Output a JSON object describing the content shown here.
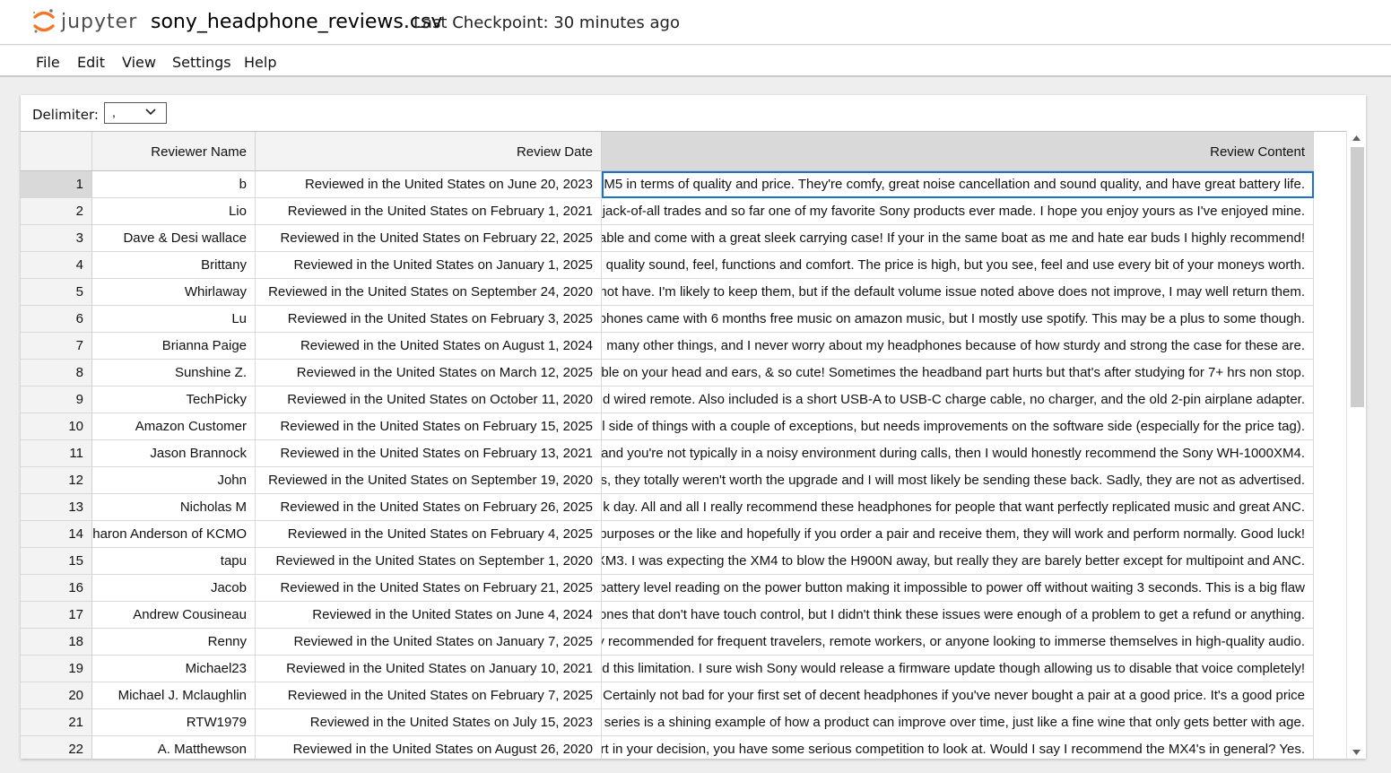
{
  "app": {
    "logo_text": "jupyter",
    "document_title": "sony_headphone_reviews.csv",
    "checkpoint": "Last Checkpoint: 30 minutes ago"
  },
  "menu": [
    "File",
    "Edit",
    "View",
    "Settings",
    "Help"
  ],
  "toolbar": {
    "delimiter_label": "Delimiter:",
    "delimiter_value": ","
  },
  "colors": {
    "selection_border": "#1a73c9",
    "header_bg": "#f3f3f3",
    "selected_header_bg": "#d9d9d9",
    "logo_orange": "#f37726"
  },
  "table": {
    "columns": [
      "Reviewer Name",
      "Review Date",
      "Review Content"
    ],
    "selected_column": "Review Content",
    "selected_row": "1",
    "rows": [
      {
        "num": "1",
        "name": "b",
        "date": "Reviewed in the United States on June 20, 2023",
        "content": "M5 in terms of quality and price. They're comfy, great noise cancellation and sound quality, and have great battery life."
      },
      {
        "num": "2",
        "name": "Lio",
        "date": "Reviewed in the United States on February 1, 2021",
        "content": "jack-of-all trades and so far one of my favorite Sony products ever made. I hope you enjoy yours as I've enjoyed mine."
      },
      {
        "num": "3",
        "name": "Dave & Desi wallace",
        "date": "Reviewed in the United States on February 22, 2025",
        "content": "able and come with a great sleek carrying case! If your in the same boat as me and hate ear buds I highly recommend!"
      },
      {
        "num": "4",
        "name": "Brittany",
        "date": "Reviewed in the United States on January 1, 2025",
        "content": " quality sound, feel, functions and comfort. The price is high, but you see, feel and use every bit of your moneys worth."
      },
      {
        "num": "5",
        "name": "Whirlaway",
        "date": "Reviewed in the United States on September 24, 2020",
        "content": "not have. I'm likely to keep them, but if the default volume issue noted above does not improve, I may well return them."
      },
      {
        "num": "6",
        "name": "Lu",
        "date": "Reviewed in the United States on February 3, 2025",
        "content": "phones came with 6 months free music on amazon music, but I mostly use spotify. This may be a plus to some though."
      },
      {
        "num": "7",
        "name": "Brianna Paige",
        "date": "Reviewed in the United States on August 1, 2024",
        "content": " many other things, and I never worry about my headphones because of how sturdy and strong the case for these are."
      },
      {
        "num": "8",
        "name": "Sunshine Z.",
        "date": "Reviewed in the United States on March 12, 2025",
        "content": "ble on your head and ears, & so cute! Sometimes the headband part hurts but that's after studying for 7+ hrs non stop."
      },
      {
        "num": "9",
        "name": "TechPicky",
        "date": "Reviewed in the United States on October 11, 2020",
        "content": "d wired remote.  Also included is a short USB-A to USB-C charge cable, no charger, and the old 2-pin airplane adapter."
      },
      {
        "num": "10",
        "name": "Amazon Customer",
        "date": "Reviewed in the United States on February 15, 2025",
        "content": "l side of things with a couple of exceptions, but needs improvements on the software side (especially for the price tag)."
      },
      {
        "num": "11",
        "name": "Jason Brannock",
        "date": "Reviewed in the United States on February 13, 2021",
        "content": "and you're not typically in a noisy environment during calls, then I would honestly recommend the Sony WH-1000XM4."
      },
      {
        "num": "12",
        "name": "John",
        "date": "Reviewed in the United States on September 19, 2020",
        "content": "s, they totally weren't worth the upgrade and I will most likely be sending these back. Sadly, they are not as advertised."
      },
      {
        "num": "13",
        "name": "Nicholas M",
        "date": "Reviewed in the United States on February 26, 2025",
        "content": "k day.  All and all I really recommend these headphones for people that want perfectly replicated music and great ANC."
      },
      {
        "num": "14",
        "name": "haron Anderson of KCMO",
        "date": "Reviewed in the United States on February 4, 2025",
        "content": "purposes or the like and hopefully if you order a pair and receive them, they will work and perform normally. Good luck!"
      },
      {
        "num": "15",
        "name": "tapu",
        "date": "Reviewed in the United States on September 1, 2020",
        "content": "XM3. I was expecting the XM4 to blow the H900N away, but really they are barely better except for multipoint and ANC."
      },
      {
        "num": "16",
        "name": "Jacob",
        "date": "Reviewed in the United States on February 21, 2025",
        "content": "battery level reading on the power button making it impossible to power off without waiting 3 seconds. This is a big flaw"
      },
      {
        "num": "17",
        "name": "Andrew Cousineau",
        "date": "Reviewed in the United States on June 4, 2024",
        "content": "ones that don't have touch control, but I didn't think these issues were enough of a problem to get a refund or anything."
      },
      {
        "num": "18",
        "name": "Renny",
        "date": "Reviewed in the United States on January 7, 2025",
        "content": "y recommended for frequent travelers, remote workers, or anyone looking to immerse themselves in high-quality audio."
      },
      {
        "num": "19",
        "name": "Michael23",
        "date": "Reviewed in the United States on January 10, 2021",
        "content": "d this limitation. I sure wish Sony would release a firmware update though allowing us to disable that voice completely!"
      },
      {
        "num": "20",
        "name": "Michael J. Mclaughlin",
        "date": "Reviewed in the United States on February 7, 2025",
        "content": "Certainly not bad for your first set of decent headphones if you've never bought a pair at a good price. It's a good price"
      },
      {
        "num": "21",
        "name": "RTW1979",
        "date": "Reviewed in the United States on July 15, 2023",
        "content": " series is a shining example of how a product can improve over time, just like a fine wine that only gets better with age."
      },
      {
        "num": "22",
        "name": "A. Matthewson",
        "date": "Reviewed in the United States on August 26, 2020",
        "content": "rt in your decision, you have some serious competition to look at. Would I say I recommend the MX4's in general? Yes."
      }
    ]
  }
}
